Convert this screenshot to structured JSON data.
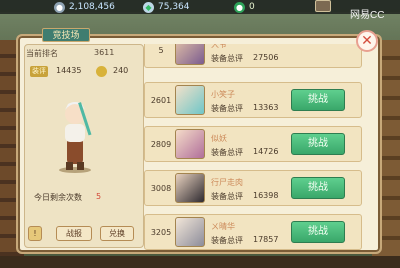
{
  "topbar": {
    "silver": "2,108,456",
    "diamond": "75,364",
    "jade": "0",
    "watermark": "网易CC"
  },
  "panel": {
    "title": "竞技场",
    "close_label": "✕"
  },
  "info": {
    "rank_label": "当前排名",
    "rank_value": "3611",
    "score_badge": "装评",
    "score_value": "14435",
    "coin_value": "240",
    "remain_label": "今日剩余次数",
    "remain_value": "5",
    "help_label": "!",
    "report_label": "战报",
    "exchange_label": "兑换"
  },
  "opponents": [
    {
      "rank": "5",
      "name": "大爷",
      "label": "装备总评",
      "score": "27506",
      "fight": ""
    },
    {
      "rank": "2601",
      "name": "小笑子",
      "label": "装备总评",
      "score": "13363",
      "fight": "挑战"
    },
    {
      "rank": "2809",
      "name": "似妖",
      "label": "装备总评",
      "score": "14726",
      "fight": "挑战"
    },
    {
      "rank": "3008",
      "name": "行尸走肉",
      "label": "装备总评",
      "score": "16398",
      "fight": "挑战"
    },
    {
      "rank": "3205",
      "name": "ㄨ晴华",
      "label": "装备总评",
      "score": "17857",
      "fight": "挑战"
    }
  ]
}
